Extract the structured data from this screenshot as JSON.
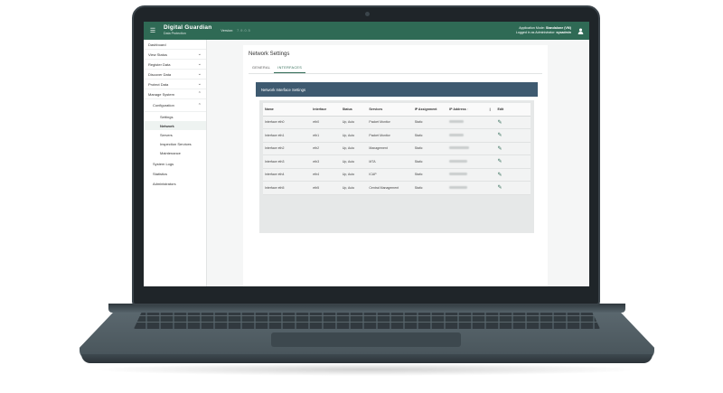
{
  "header": {
    "brand_name": "Digital Guardian",
    "brand_sub": "Data Protection",
    "version_label": "Version:",
    "version_value": "7.9.0.5",
    "app_mode_label": "Application Mode:",
    "app_mode_value": "Standalone (VM)",
    "logged_in_label": "Logged in as Administrator:",
    "logged_in_value": "sysadmin"
  },
  "sidebar": {
    "items": [
      {
        "label": "Dashboard"
      },
      {
        "label": "View Status"
      },
      {
        "label": "Register Data"
      },
      {
        "label": "Discover Data"
      },
      {
        "label": "Protect Data"
      },
      {
        "label": "Manage System"
      }
    ],
    "configuration_label": "Configuration",
    "config_items": [
      {
        "label": "Settings"
      },
      {
        "label": "Network"
      },
      {
        "label": "Servers"
      },
      {
        "label": "Inspection Services"
      },
      {
        "label": "Maintenance"
      }
    ],
    "lower_items": [
      {
        "label": "System Logs"
      },
      {
        "label": "Statistics"
      },
      {
        "label": "Administrators"
      }
    ]
  },
  "page": {
    "title": "Network Settings",
    "tabs": [
      {
        "label": "GENERAL"
      },
      {
        "label": "INTERFACES"
      }
    ],
    "panel_title": "Network Interface Settings"
  },
  "table": {
    "headers": [
      "Name",
      "Interface",
      "Status",
      "Services",
      "IP Assignment",
      "IP Address",
      "Edit"
    ],
    "rows": [
      {
        "name": "Interface eth0",
        "iface": "eth0",
        "status": "Up, Auto",
        "services": "Packet Monitor",
        "assignment": "Static"
      },
      {
        "name": "Interface eth1",
        "iface": "eth1",
        "status": "Up, Auto",
        "services": "Packet Monitor",
        "assignment": "Static"
      },
      {
        "name": "Interface eth2",
        "iface": "eth2",
        "status": "Up, Auto",
        "services": "Management",
        "assignment": "Static"
      },
      {
        "name": "Interface eth3",
        "iface": "eth3",
        "status": "Up, Auto",
        "services": "MTA",
        "assignment": "Static"
      },
      {
        "name": "Interface eth4",
        "iface": "eth4",
        "status": "Up, Auto",
        "services": "ICAP",
        "assignment": "Static"
      },
      {
        "name": "Interface eth5",
        "iface": "eth5",
        "status": "Up, Auto",
        "services": "Central Management",
        "assignment": "Static"
      }
    ]
  },
  "icons": {
    "menu": "menu-icon",
    "user": "user-icon",
    "chevron": "chevron-icon",
    "edit": "pencil-icon",
    "sort": "sort-arrow-icon"
  },
  "colors": {
    "brand_green": "#2f6a55",
    "panel_header": "#3e5a70"
  }
}
